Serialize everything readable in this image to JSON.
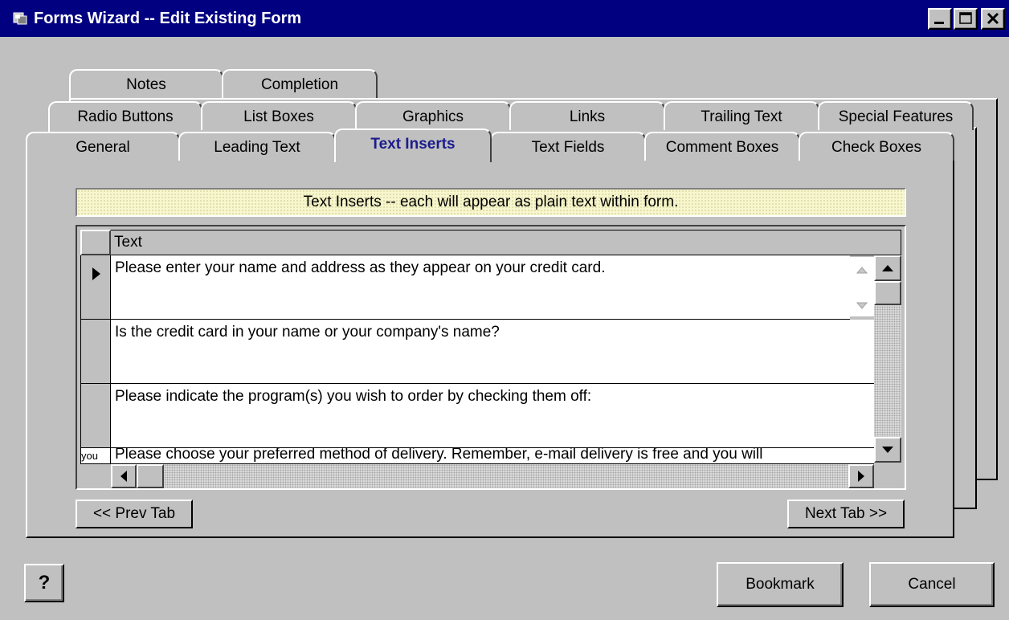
{
  "window": {
    "title": "Forms Wizard -- Edit Existing Form"
  },
  "caption_buttons": {
    "minimize": "minimize-icon",
    "maximize": "maximize-icon",
    "close": "close-icon"
  },
  "tabs": {
    "row1": [
      "Notes",
      "Completion"
    ],
    "row2": [
      "Radio Buttons",
      "List Boxes",
      "Graphics",
      "Links",
      "Trailing Text",
      "Special Features"
    ],
    "row3": [
      "General",
      "Leading Text",
      "Text Inserts",
      "Text Fields",
      "Comment Boxes",
      "Check Boxes"
    ],
    "active": "Text Inserts"
  },
  "banner": {
    "text": "Text Inserts -- each will appear as plain text within form."
  },
  "grid": {
    "column_header": "Text",
    "rows": [
      "Please enter your name and address as they appear on your credit card.",
      "Is the credit card in your name or your company's name?",
      "Please indicate the program(s) you wish to order by checking them off:",
      "Please choose your preferred method of delivery.  Remember, e-mail delivery is free and you will"
    ],
    "editor_fragment": "you"
  },
  "buttons": {
    "prev_tab": "<< Prev Tab",
    "next_tab": "Next Tab >>",
    "help": "?",
    "bookmark": "Bookmark",
    "cancel": "Cancel"
  },
  "colors": {
    "titlebar": "#000080",
    "face": "#c0c0c0",
    "banner": "#f8f6cc",
    "active_tab_text": "#1c1c8c"
  }
}
